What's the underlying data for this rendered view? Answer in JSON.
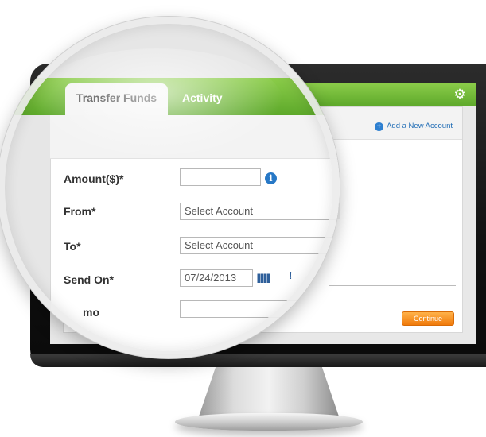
{
  "tabs": [
    {
      "label": "Transfer Funds",
      "active": true
    },
    {
      "label": "Activity",
      "active": false
    }
  ],
  "settings_icon": "gear-icon",
  "add_account": {
    "label": "Add a New Account",
    "icon": "plus-circle-icon"
  },
  "form": {
    "amount": {
      "label": "Amount($)*",
      "value": "",
      "icon": "info-icon"
    },
    "from": {
      "label": "From*",
      "value": "Select Account"
    },
    "to": {
      "label": "To*",
      "value": "Select Account"
    },
    "send_on": {
      "label": "Send On*",
      "value": "07/24/2013",
      "icon": "calendar-icon"
    },
    "memo": {
      "label": "Memo (partially hidden)",
      "visible_text": "mo",
      "value": ""
    }
  },
  "continue_button": {
    "label": "Continue"
  },
  "colors": {
    "tab_green": "#6cb535",
    "continue_orange": "#f28c1e",
    "link_blue": "#1f6cb5"
  }
}
